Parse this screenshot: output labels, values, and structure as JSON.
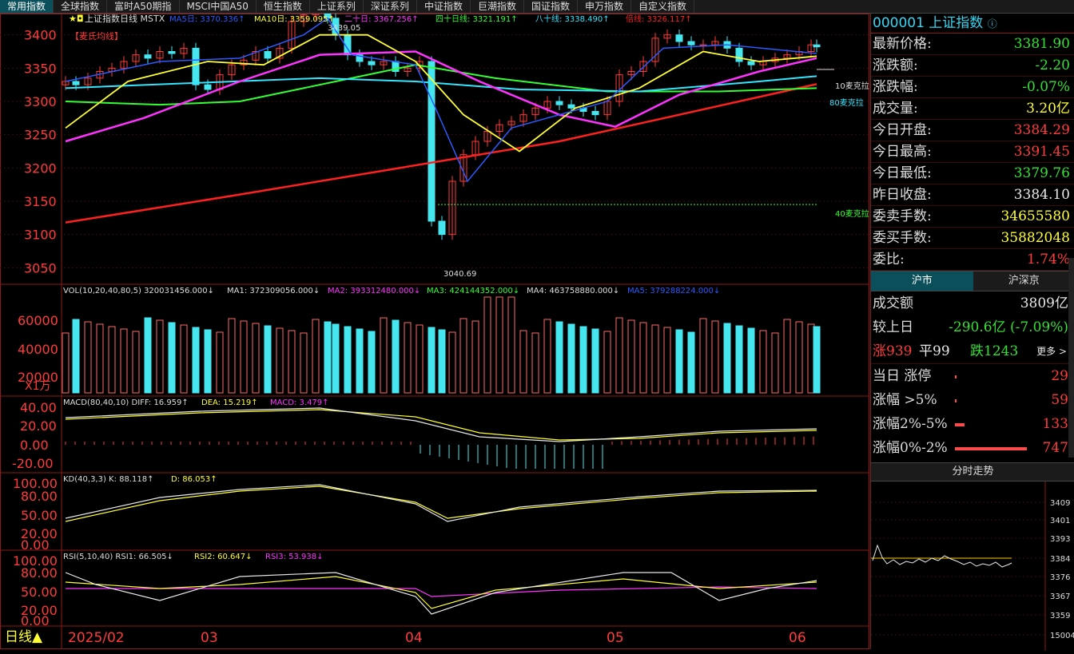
{
  "menu": {
    "tabs": [
      "常用指数",
      "全球指数",
      "富时A50期指",
      "MSCI中国A50",
      "恒生指数",
      "上证系列",
      "深证系列",
      "中证指数",
      "巨潮指数",
      "国证指数",
      "申万指数",
      "自定义指数"
    ]
  },
  "header": {
    "stars": "★◘",
    "title": "上证指数日线 MSTX",
    "ma5": "MA5日: 3370.336↑",
    "ma10": "MA10日: 3359.095↑",
    "ma20": "二十日: 3367.256↑",
    "ma40": "四十日线: 3321.191↑",
    "ma80": "八十线: 3338.490↑",
    "ma_double": "倍线: 3326.117↑",
    "indicator_tag": "【麦氏均线】",
    "high_label": "3439.05",
    "low_label": "3040.69",
    "label_10": "10麦克拉",
    "label_80": "80麦克拉",
    "label_40": "40麦克拉"
  },
  "price_axis": [
    "3400",
    "3350",
    "3300",
    "3250",
    "3200",
    "3150",
    "3100",
    "3050"
  ],
  "vol": {
    "header": "VOL(10,20,40,80,5) 320031456.000↓",
    "ma1": "MA1: 372309056.000↓",
    "ma2": "MA2: 393312480.000↓",
    "ma3": "MA3: 424144352.000↓",
    "ma4": "MA4: 463758880.000↓",
    "ma5": "MA5: 379288224.000↓",
    "axis": [
      "60000",
      "40000",
      "20000"
    ],
    "unit": "X1万"
  },
  "macd": {
    "header": "MACD(80,40,10) DIFF: 16.959↑",
    "dea": "DEA: 15.219↑",
    "macd": "MACD: 3.479↑",
    "axis": [
      "40.00",
      "20.00",
      "0.00",
      "-20.00"
    ]
  },
  "kd": {
    "header": "KD(40,3,3) K: 88.118↑",
    "d": "D: 86.053↑",
    "axis": [
      "100.00",
      "80.00",
      "50.00",
      "20.00",
      "0.00"
    ]
  },
  "rsi": {
    "header": "RSI(5,10,40) RSI1: 66.505↓",
    "rsi2": "RSI2: 60.647↓",
    "rsi3": "RSI3: 53.938↓",
    "axis": [
      "100.00",
      "80.00",
      "50.00",
      "20.00",
      "0.00"
    ]
  },
  "timeline": {
    "period": "日线▲",
    "months": [
      "2025/02",
      "03",
      "04",
      "05",
      "06"
    ]
  },
  "quote": {
    "code_name": "000001 上证指数",
    "rows": [
      {
        "label": "最新价格:",
        "value": "3381.90",
        "color": "#35e035"
      },
      {
        "label": "涨跌额:",
        "value": "-2.20",
        "color": "#35e035"
      },
      {
        "label": "涨跌幅:",
        "value": "-0.07%",
        "color": "#35e035"
      },
      {
        "label": "成交量:",
        "value": "3.20亿",
        "color": "#ffff33"
      },
      {
        "label": "今日开盘:",
        "value": "3384.29",
        "color": "#ff3b3b"
      },
      {
        "label": "今日最高:",
        "value": "3391.45",
        "color": "#ff3b3b"
      },
      {
        "label": "今日最低:",
        "value": "3379.76",
        "color": "#35e035"
      },
      {
        "label": "昨日收盘:",
        "value": "3384.10",
        "color": "#e8e8e8"
      },
      {
        "label": "委卖手数:",
        "value": "34655580",
        "color": "#ffff33"
      },
      {
        "label": "委买手数:",
        "value": "35882048",
        "color": "#ffff33"
      },
      {
        "label": "委比:",
        "value": "1.74%",
        "color": "#ff3b3b"
      }
    ]
  },
  "market": {
    "tabs": [
      "沪市",
      "沪深京"
    ],
    "turnover_label": "成交额",
    "turnover_value": "3809亿",
    "vs_label": "较上日",
    "vs_value": "-290.6亿 (-7.09%)",
    "up": "涨939",
    "flat": "平99",
    "down": "跌1243",
    "more": "更多 >",
    "stats": [
      {
        "label": "当日 涨停",
        "value": "29",
        "bar": 0.0
      },
      {
        "label": "涨幅 >5%",
        "value": "59",
        "bar": 0.01
      },
      {
        "label": "涨幅2%-5%",
        "value": "133",
        "bar": 0.06
      },
      {
        "label": "涨幅0%-2%",
        "value": "747",
        "bar": 0.45
      }
    ]
  },
  "mini": {
    "title": "分时走势",
    "axis": [
      "3409",
      "3401",
      "3393",
      "3384",
      "3376",
      "3367",
      "3359",
      "15004"
    ]
  },
  "colors": {
    "up": "#ff3b3b",
    "down": "#46e6f0",
    "ma5": "#2a5bff",
    "ma10": "#ffff33",
    "ma20": "#ff33ff",
    "ma40": "#33ff33",
    "ma80": "#33e6ff",
    "double": "#ff2020"
  }
}
